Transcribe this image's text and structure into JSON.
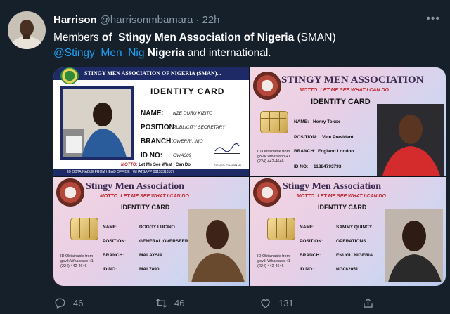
{
  "tweet": {
    "author_name": "Harrison",
    "handle": "@harrisonmbamara",
    "separator": "·",
    "time": "22h",
    "more_glyph": "•••",
    "text": {
      "members_pre": "Members ",
      "of": "of",
      "org_name": "Stingy Men Association of Nigeria",
      "abbr": " (SMAN)",
      "mention": "@Stingy_Men_",
      "nig": "Nig",
      "nigeria": "Nigeria",
      "tail": " and international."
    }
  },
  "cards": [
    {
      "header": "STINGY MEN ASSOCIATION OF NIGERIA (SMAN)...",
      "title": "IDENTITY CARD",
      "labels": {
        "name": "NAME:",
        "position": "POSITION:",
        "branch": "BRANCH:",
        "id": "ID NO:"
      },
      "values": {
        "name": "NZE DURU KIZITO",
        "position": "PUBLICITY SECRETARY",
        "branch": "OWERRI, IMO",
        "id": "GWA309"
      },
      "motto_label": "MOTTO:",
      "motto": "Let Me See What I Can Do",
      "footer": "ID OBTAINABLE FROM HEAD OFFICE : WHATSAPP 08118318187",
      "signature": "SIGNED: CHAIRMAN"
    },
    {
      "assoc": "STINGY MEN ASSOCIATION",
      "motto": "MOTTO: LET ME SEE WHAT I CAN DO",
      "title": "IDENTITY CARD",
      "obtainable": "ID Obtainable from gov.k Whatsapp +1 (224) 442-4646",
      "labels": {
        "name": "NAME:",
        "position": "POSITION:",
        "branch": "BRANCH:",
        "id": "ID NO:"
      },
      "values": {
        "name": "Henry Tokex",
        "position": "Vice President",
        "branch": "England London",
        "id": "11884793793"
      }
    },
    {
      "assoc": "Stingy Men Association",
      "motto": "MOTTO: LET ME SEE WHAT I CAN DO",
      "title": "IDENTITY CARD",
      "obtainable": "ID Obtainable from gov.k Whatsapp +1 (224) 442-4646",
      "labels": {
        "name": "NAME:",
        "position": "POSITION:",
        "branch": "BRANCH:",
        "id": "ID NO:"
      },
      "values": {
        "name": "DOGGY LUCINO",
        "position": "GENERAL OVERSEER",
        "branch": "MALAYSIA",
        "id": "MAL7890"
      }
    },
    {
      "assoc": "Stingy Men Association",
      "motto": "MOTTO: LET ME SEE WHAT I CAN DO",
      "title": "IDENTITY CARD",
      "obtainable": "ID Obtainable from gov.k Whatsapp +1 (224) 442-4646",
      "labels": {
        "name": "NAME:",
        "position": "POSITION:",
        "branch": "BRANCH:",
        "id": "ID NO:"
      },
      "values": {
        "name": "SAMMY QUINCY",
        "position": "OPERATIONS",
        "branch": "ENUGU NIGERIA",
        "id": "NG082051"
      }
    }
  ],
  "actions": {
    "replies": "46",
    "retweets": "46",
    "likes": "131"
  }
}
